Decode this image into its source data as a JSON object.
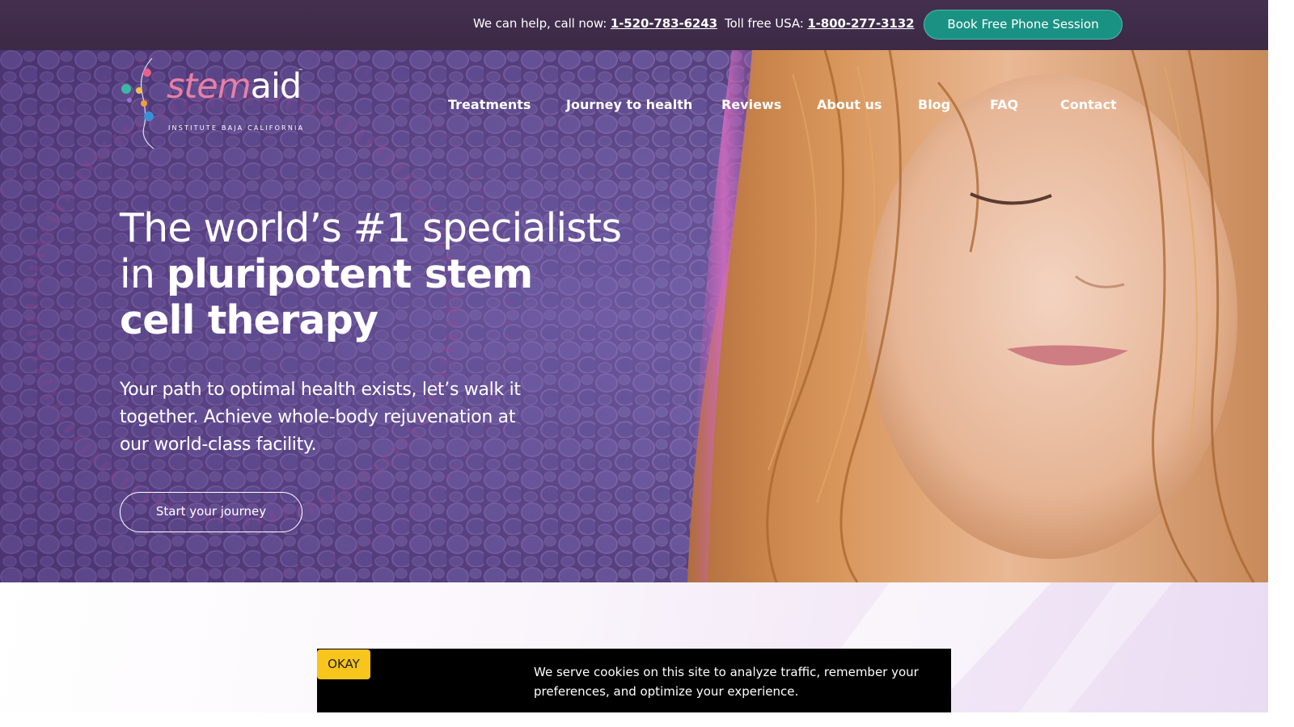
{
  "topbar": {
    "help_prefix": "We can help, call now: ",
    "help_phone": "1-520-783-6243",
    "tollfree_prefix": "Toll free USA: ",
    "tollfree_phone": "1-800-277-3132",
    "book_button": "Book Free Phone Session"
  },
  "logo": {
    "word_part1": "stem",
    "word_part2": "aid",
    "tagline": "INSTITUTE BAJA CALIFORNIA"
  },
  "nav": {
    "items": [
      {
        "label": "Treatments"
      },
      {
        "label": "Journey to health"
      },
      {
        "label": "Reviews"
      },
      {
        "label": "About us"
      },
      {
        "label": "Blog"
      },
      {
        "label": "FAQ"
      },
      {
        "label": "Contact"
      }
    ]
  },
  "hero": {
    "headline_line1": "The world’s #1 specialists",
    "headline_in": "in ",
    "headline_bold1": "pluripotent stem",
    "headline_bold2": "cell therapy",
    "lead": "Your path to optimal health exists, let’s walk it together. Achieve whole-body rejuvenation at our world-class facility.",
    "cta": "Start your journey"
  },
  "cookie": {
    "okay": "OKAY",
    "message": "We serve cookies on this site to analyze traffic, remember your preferences, and optimize your experience."
  },
  "colors": {
    "topbar": "#44304f",
    "book_button": "#1a9283",
    "logo_pink": "#e97fa6",
    "okay_button": "#f7c51b"
  }
}
